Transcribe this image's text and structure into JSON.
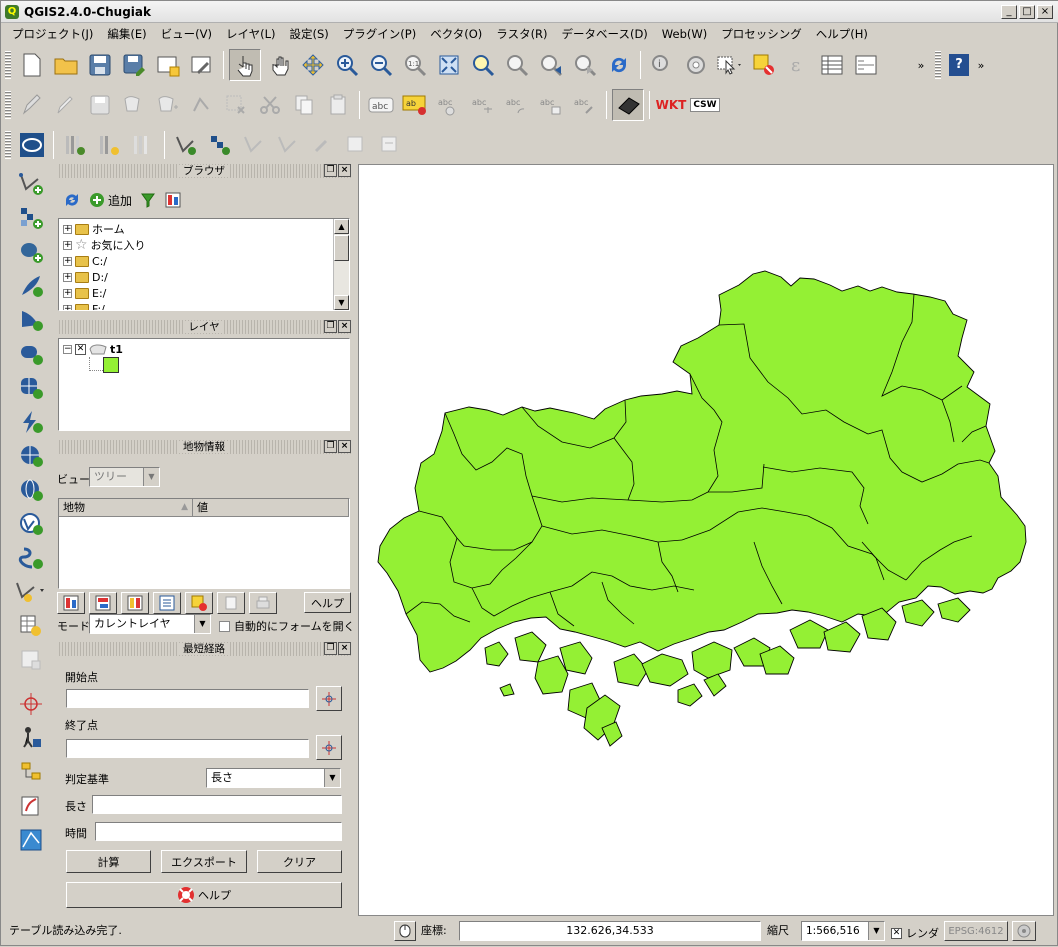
{
  "window": {
    "title": "QGIS2.4.0-Chugiak",
    "minimize": "_",
    "maximize": "□",
    "close": "×"
  },
  "menu": [
    "プロジェクト(J)",
    "編集(E)",
    "ビュー(V)",
    "レイヤ(L)",
    "設定(S)",
    "プラグイン(P)",
    "ベクタ(O)",
    "ラスタ(R)",
    "データベース(D)",
    "Web(W)",
    "プロセッシング",
    "ヘルプ(H)"
  ],
  "toolbar": {
    "overflow": "»",
    "help": "?",
    "abc": "abc",
    "wkt": "WKT",
    "csw": "CSW"
  },
  "browser": {
    "title": "ブラウザ",
    "add_label": "追加",
    "items": [
      "ホーム",
      "お気に入り",
      "C:/",
      "D:/",
      "E:/",
      "F:/"
    ]
  },
  "layers": {
    "title": "レイヤ",
    "items": [
      {
        "name": "t1",
        "color": "#94f034"
      }
    ]
  },
  "identify": {
    "title": "地物情報",
    "view_label": "ビュー",
    "view_value": "ツリー",
    "col_feature": "地物",
    "col_value": "値",
    "help": "ヘルプ",
    "mode_label": "モード",
    "mode_value": "カレントレイヤ",
    "auto_form": "自動的にフォームを開く"
  },
  "route": {
    "title": "最短経路",
    "start_label": "開始点",
    "end_label": "終了点",
    "criterion_label": "判定基準",
    "criterion_value": "長さ",
    "length_label": "長さ",
    "time_label": "時間",
    "calc": "計算",
    "export": "エクスポート",
    "clear": "クリア",
    "help": "ヘルプ"
  },
  "status": {
    "message": "テーブル読み込み完了.",
    "coord_label": "座標:",
    "coord_value": "132.626,34.533",
    "scale_label": "縮尺",
    "scale_value": "1:566,516",
    "render_label": "レンダ",
    "crs": "EPSG:4612"
  },
  "colors": {
    "fill": "#94f034",
    "accent": "#1f5fb0"
  }
}
